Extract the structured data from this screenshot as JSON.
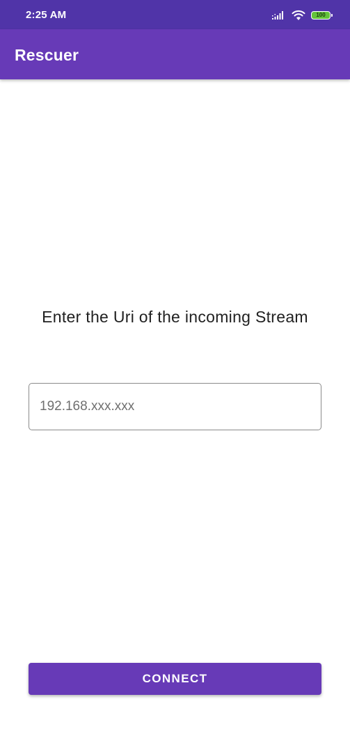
{
  "status_bar": {
    "time": "2:25 AM",
    "battery": "100",
    "icons": [
      "signal-icon",
      "wifi-icon",
      "battery-icon"
    ]
  },
  "app_bar": {
    "title": "Rescuer"
  },
  "main": {
    "prompt": "Enter the Uri of the incoming Stream",
    "uri_input": {
      "value": "",
      "placeholder": "192.168.xxx.xxx"
    },
    "connect_label": "CONNECT"
  },
  "colors": {
    "status_bar": "#5034a8",
    "primary": "#673ab7",
    "battery_fill": "#63c33a"
  }
}
